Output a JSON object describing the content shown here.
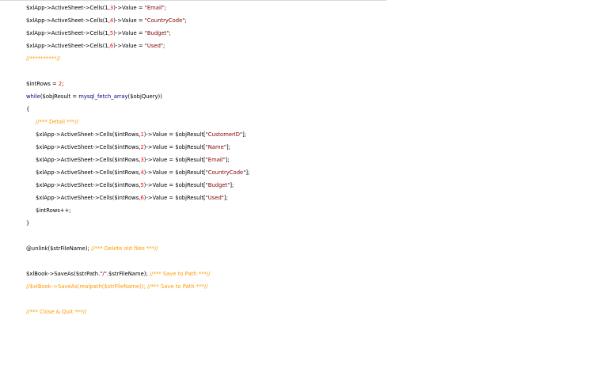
{
  "colors": {
    "background": "#ffffff",
    "plain": "#000000",
    "string": "#800000",
    "number": "#ff0000",
    "keyword": "#000080",
    "comment": "#ff9900"
  },
  "code": {
    "lines": [
      {
        "indent": false,
        "tokens": [
          {
            "t": "plain",
            "v": "$xlApp->ActiveSheet->Cells(1,"
          },
          {
            "t": "num",
            "v": "3"
          },
          {
            "t": "plain",
            "v": ")->Value = "
          },
          {
            "t": "str",
            "v": "\"Email\""
          },
          {
            "t": "plain",
            "v": ";"
          }
        ]
      },
      {
        "indent": false,
        "tokens": [
          {
            "t": "plain",
            "v": "$xlApp->ActiveSheet->Cells(1,"
          },
          {
            "t": "num",
            "v": "4"
          },
          {
            "t": "plain",
            "v": ")->Value = "
          },
          {
            "t": "str",
            "v": "\"CountryCode\""
          },
          {
            "t": "plain",
            "v": ";"
          }
        ]
      },
      {
        "indent": false,
        "tokens": [
          {
            "t": "plain",
            "v": "$xlApp->ActiveSheet->Cells(1,"
          },
          {
            "t": "num",
            "v": "5"
          },
          {
            "t": "plain",
            "v": ")->Value = "
          },
          {
            "t": "str",
            "v": "\"Budget\""
          },
          {
            "t": "plain",
            "v": ";"
          }
        ]
      },
      {
        "indent": false,
        "tokens": [
          {
            "t": "plain",
            "v": "$xlApp->ActiveSheet->Cells(1,"
          },
          {
            "t": "num",
            "v": "6"
          },
          {
            "t": "plain",
            "v": ")->Value = "
          },
          {
            "t": "str",
            "v": "\"Used\""
          },
          {
            "t": "plain",
            "v": ";"
          }
        ]
      },
      {
        "indent": false,
        "tokens": [
          {
            "t": "com",
            "v": "//**********//"
          }
        ]
      },
      {
        "indent": false,
        "tokens": []
      },
      {
        "indent": false,
        "tokens": [
          {
            "t": "plain",
            "v": "$intRows = "
          },
          {
            "t": "num",
            "v": "2"
          },
          {
            "t": "plain",
            "v": ";"
          }
        ]
      },
      {
        "indent": false,
        "tokens": [
          {
            "t": "kw",
            "v": "while"
          },
          {
            "t": "plain",
            "v": "($objResult = "
          },
          {
            "t": "kw",
            "v": "mysql_fetch_array"
          },
          {
            "t": "plain",
            "v": "($objQuery))"
          }
        ]
      },
      {
        "indent": false,
        "tokens": [
          {
            "t": "plain",
            "v": "{"
          }
        ]
      },
      {
        "indent": true,
        "tokens": [
          {
            "t": "com",
            "v": "//*** Detail ***//"
          }
        ]
      },
      {
        "indent": true,
        "tokens": [
          {
            "t": "plain",
            "v": "$xlApp->ActiveSheet->Cells($intRows,"
          },
          {
            "t": "num",
            "v": "1"
          },
          {
            "t": "plain",
            "v": ")->Value = $objResult["
          },
          {
            "t": "str",
            "v": "\"CustomerID\""
          },
          {
            "t": "plain",
            "v": "];"
          }
        ]
      },
      {
        "indent": true,
        "tokens": [
          {
            "t": "plain",
            "v": "$xlApp->ActiveSheet->Cells($intRows,"
          },
          {
            "t": "num",
            "v": "2"
          },
          {
            "t": "plain",
            "v": ")->Value = $objResult["
          },
          {
            "t": "str",
            "v": "\"Name\""
          },
          {
            "t": "plain",
            "v": "];"
          }
        ]
      },
      {
        "indent": true,
        "tokens": [
          {
            "t": "plain",
            "v": "$xlApp->ActiveSheet->Cells($intRows,"
          },
          {
            "t": "num",
            "v": "3"
          },
          {
            "t": "plain",
            "v": ")->Value = $objResult["
          },
          {
            "t": "str",
            "v": "\"Email\""
          },
          {
            "t": "plain",
            "v": "];"
          }
        ]
      },
      {
        "indent": true,
        "tokens": [
          {
            "t": "plain",
            "v": "$xlApp->ActiveSheet->Cells($intRows,"
          },
          {
            "t": "num",
            "v": "4"
          },
          {
            "t": "plain",
            "v": ")->Value = $objResult["
          },
          {
            "t": "str",
            "v": "\"CountryCode\""
          },
          {
            "t": "plain",
            "v": "];"
          }
        ]
      },
      {
        "indent": true,
        "tokens": [
          {
            "t": "plain",
            "v": "$xlApp->ActiveSheet->Cells($intRows,"
          },
          {
            "t": "num",
            "v": "5"
          },
          {
            "t": "plain",
            "v": ")->Value = $objResult["
          },
          {
            "t": "str",
            "v": "\"Budget\""
          },
          {
            "t": "plain",
            "v": "];"
          }
        ]
      },
      {
        "indent": true,
        "tokens": [
          {
            "t": "plain",
            "v": "$xlApp->ActiveSheet->Cells($intRows,"
          },
          {
            "t": "num",
            "v": "6"
          },
          {
            "t": "plain",
            "v": ")->Value = $objResult["
          },
          {
            "t": "str",
            "v": "\"Used\""
          },
          {
            "t": "plain",
            "v": "];"
          }
        ]
      },
      {
        "indent": true,
        "tokens": [
          {
            "t": "plain",
            "v": "$intRows++;"
          }
        ]
      },
      {
        "indent": false,
        "tokens": [
          {
            "t": "plain",
            "v": "}"
          }
        ]
      },
      {
        "indent": false,
        "tokens": []
      },
      {
        "indent": false,
        "tokens": [
          {
            "t": "plain",
            "v": "@unlink($strFileName); "
          },
          {
            "t": "com",
            "v": "//*** Delete old files ***//"
          }
        ]
      },
      {
        "indent": false,
        "tokens": []
      },
      {
        "indent": false,
        "tokens": [
          {
            "t": "plain",
            "v": "$xlBook->SaveAs($strPath."
          },
          {
            "t": "str",
            "v": "\"/\""
          },
          {
            "t": "plain",
            "v": ".$strFileName); "
          },
          {
            "t": "com",
            "v": "//*** Save to Path ***//"
          }
        ]
      },
      {
        "indent": false,
        "tokens": [
          {
            "t": "com",
            "v": "//$xlBook->SaveAs(realpath($strFileName)); //*** Save to Path ***//"
          }
        ]
      },
      {
        "indent": false,
        "tokens": []
      },
      {
        "indent": false,
        "tokens": [
          {
            "t": "com",
            "v": "//*** Close & Quit ***//"
          }
        ]
      }
    ]
  }
}
